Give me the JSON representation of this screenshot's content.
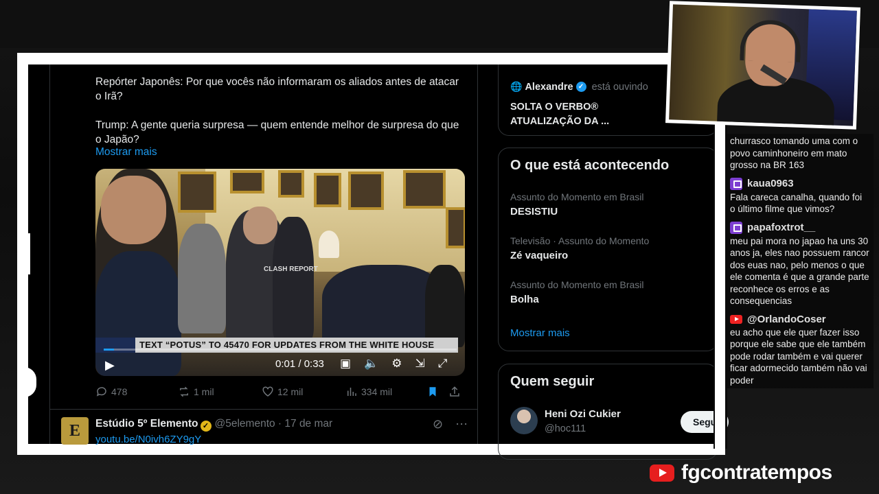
{
  "tweet": {
    "paragraph1": "Repórter Japonês: Por que vocês não informaram os aliados antes de atacar o Irã?",
    "paragraph2": "Trump: A gente queria surpresa — quem entende melhor de surpresa do que o Japão?",
    "show_more": "Mostrar mais",
    "video": {
      "ticker": "TEXT “POTUS” TO 45470 FOR UPDATES FROM THE WHITE HOUSE",
      "watermark": "CLASH REPORT",
      "time": "0:01 / 0:33",
      "progress": 0.03
    },
    "stats": {
      "replies": "478",
      "reposts": "1 mil",
      "likes": "12 mil",
      "views": "334 mil"
    }
  },
  "next_tweet": {
    "name": "Estúdio 5º Elemento",
    "handle": "@5elemento · 17 de mar",
    "link": "youtu.be/N0ivh6ZY9gY",
    "avatar_text": "E"
  },
  "space": {
    "user": "Alexandre",
    "status": "está ouvindo",
    "title": "SOLTA O VERBO® ATUALIZAÇÃO DA ..."
  },
  "happening": {
    "title": "O que está acontecendo",
    "trends": [
      {
        "meta": "Assunto do Momento em Brasil",
        "name": "DESISTIU"
      },
      {
        "meta": "Televisão · Assunto do Momento",
        "name": "Zé vaqueiro"
      },
      {
        "meta": "Assunto do Momento em Brasil",
        "name": "Bolha"
      }
    ],
    "show_more": "Mostrar mais"
  },
  "who_to_follow": {
    "title": "Quem seguir",
    "users": [
      {
        "name": "Heni Ozi Cukier",
        "handle": "@hoc111",
        "button": "Seguir"
      }
    ]
  },
  "chat": {
    "messages": [
      {
        "platform": "none",
        "user": "",
        "text": "churrasco tomando uma com o povo caminhoneiro em mato grosso na BR 163"
      },
      {
        "platform": "twitch",
        "user": "kaua0963",
        "text": "Fala careca canalha, quando foi o último filme que vimos?"
      },
      {
        "platform": "twitch",
        "user": "papafoxtrot__",
        "text": "meu pai mora no japao ha uns 30 anos ja, eles nao possuem rancor dos euas nao, pelo menos o que ele comenta é que a grande parte reconhece os erros e as consequencias"
      },
      {
        "platform": "youtube",
        "user": "@OrlandoCoser",
        "text": "eu acho que ele quer fazer isso porque ele sabe que ele também pode rodar também e vai querer ficar adormecido também não vai poder"
      }
    ]
  },
  "brand": {
    "name": "fgcontratempos"
  },
  "colors": {
    "accent": "#1d9bf0",
    "twitch": "#7d3fd1",
    "youtube": "#e61e1e",
    "background": "#000000"
  }
}
